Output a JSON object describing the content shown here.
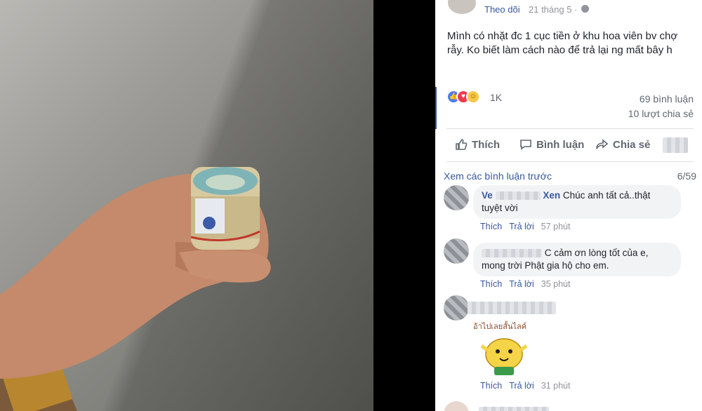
{
  "photo": {
    "description_icon": "hand-holding-money-roll-icon"
  },
  "post": {
    "follow_label": "Theo dõi",
    "date": "21 tháng 5 ·",
    "text": "Mình có nhặt đc 1 cục tiền ở khu hoa viên bv chợ rẫy. Ko biết làm cách nào để trả lại ng mất bây h",
    "reaction_count": "1K",
    "comments_count": "69 bình luận",
    "shares_count": "10 lượt chia sẻ"
  },
  "actions": {
    "like": "Thích",
    "comment": "Bình luận",
    "share": "Chia sẻ"
  },
  "comments_header": {
    "view_previous": "Xem các bình luận trước",
    "pager": "6/59"
  },
  "comments": [
    {
      "name_partial": "Ve",
      "name_tail": "Xen",
      "text_line1": "Chúc anh tất cả..thật",
      "text_line2": "tuyệt vời",
      "like": "Thích",
      "reply": "Trả lời",
      "time": "57 phút"
    },
    {
      "text_line1": "C cảm ơn lòng tốt của e,",
      "text_line2": "mong trời Phật gia hộ cho em.",
      "like": "Thích",
      "reply": "Trả lời",
      "time": "35 phút"
    },
    {
      "sticker_text": "อ้าไปเลยสั้นไลค์",
      "like": "Thích",
      "reply": "Trả lời",
      "time": "31 phút"
    }
  ],
  "colors": {
    "link": "#385898",
    "meta": "#90949c",
    "bubble": "#f2f3f5"
  }
}
